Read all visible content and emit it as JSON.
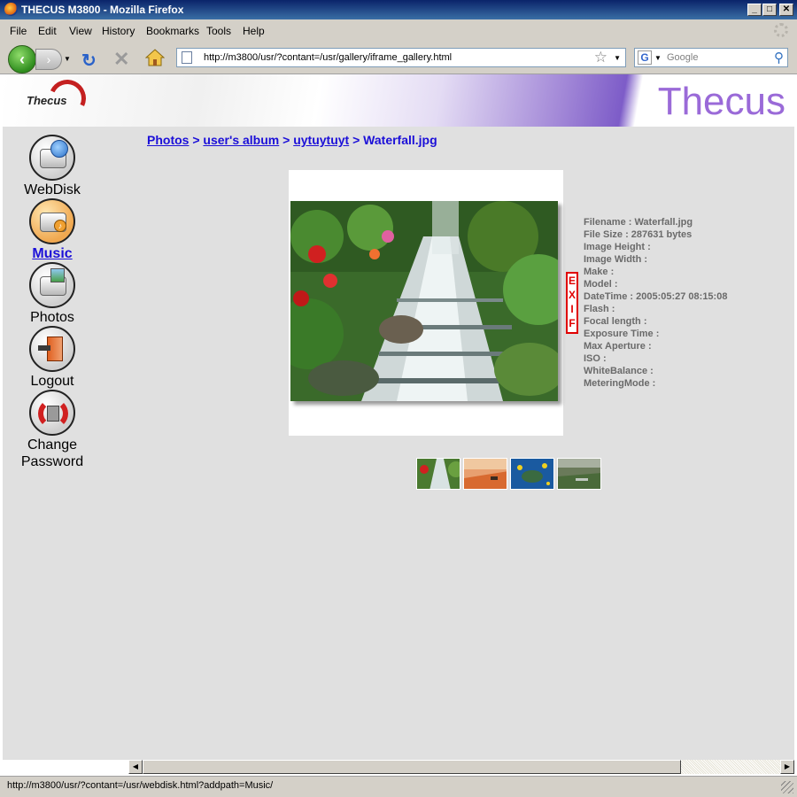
{
  "window": {
    "title": "THECUS M3800 - Mozilla Firefox"
  },
  "menu": [
    "File",
    "Edit",
    "View",
    "History",
    "Bookmarks",
    "Tools",
    "Help"
  ],
  "nav": {
    "url": "http://m3800/usr/?contant=/usr/gallery/iframe_gallery.html",
    "search_placeholder": "Google",
    "search_engine_letter": "G"
  },
  "header": {
    "logo_text": "Thecus",
    "brand_text": "Thecus"
  },
  "sidebar": {
    "items": [
      {
        "label": "WebDisk",
        "icon": "webdisk-icon",
        "active": false
      },
      {
        "label": "Music",
        "icon": "music-icon",
        "active": true
      },
      {
        "label": "Photos",
        "icon": "photos-icon",
        "active": false
      },
      {
        "label": "Logout",
        "icon": "logout-icon",
        "active": false
      },
      {
        "label": "Change\nPassword",
        "icon": "change-password-icon",
        "active": false
      }
    ]
  },
  "breadcrumb": {
    "links": [
      "Photos",
      "user's album",
      "uytuytuyt"
    ],
    "separator": ">",
    "current": "Waterfall.jpg"
  },
  "exif_tab": "EXIF",
  "exif": [
    "Filename : Waterfall.jpg",
    "File Size : 287631 bytes",
    "Image Height :",
    "Image Width :",
    "Make :",
    "Model :",
    "DateTime : 2005:05:27 08:15:08",
    "Flash :",
    "Focal length :",
    "Exposure Time :",
    "Max Aperture :",
    "ISO :",
    "WhiteBalance :",
    "MeteringMode :"
  ],
  "thumbnails": [
    "waterfall-thumbnail",
    "desert-thumbnail",
    "sea-turtle-thumbnail",
    "landscape-thumbnail"
  ],
  "status": {
    "text": "http://m3800/usr/?contant=/usr/webdisk.html?addpath=Music/"
  },
  "colors": {
    "link": "#1b0fd8",
    "exif_border": "#e00000",
    "brand": "#9a6ad8",
    "content_bg": "#e0e0e0"
  }
}
